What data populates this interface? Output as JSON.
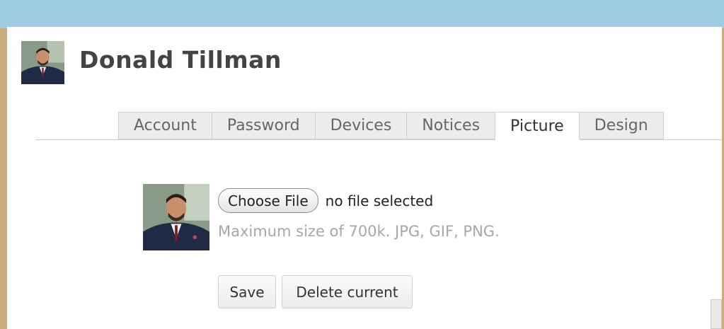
{
  "profile": {
    "name": "Donald Tillman"
  },
  "tabs": [
    {
      "label": "Account",
      "active": false
    },
    {
      "label": "Password",
      "active": false
    },
    {
      "label": "Devices",
      "active": false
    },
    {
      "label": "Notices",
      "active": false
    },
    {
      "label": "Picture",
      "active": true
    },
    {
      "label": "Design",
      "active": false
    }
  ],
  "picture_form": {
    "choose_file_label": "Choose File",
    "file_status": "no file selected",
    "hint": "Maximum size of 700k. JPG, GIF, PNG.",
    "save_label": "Save",
    "delete_label": "Delete current"
  },
  "colors": {
    "page_background": "#c9ad7e",
    "top_band": "#9fcde2",
    "panel": "#ffffff",
    "hint_text": "#a7a7a7"
  },
  "icons": {
    "header_avatar": "avatar-photo",
    "picture_preview": "avatar-photo"
  }
}
